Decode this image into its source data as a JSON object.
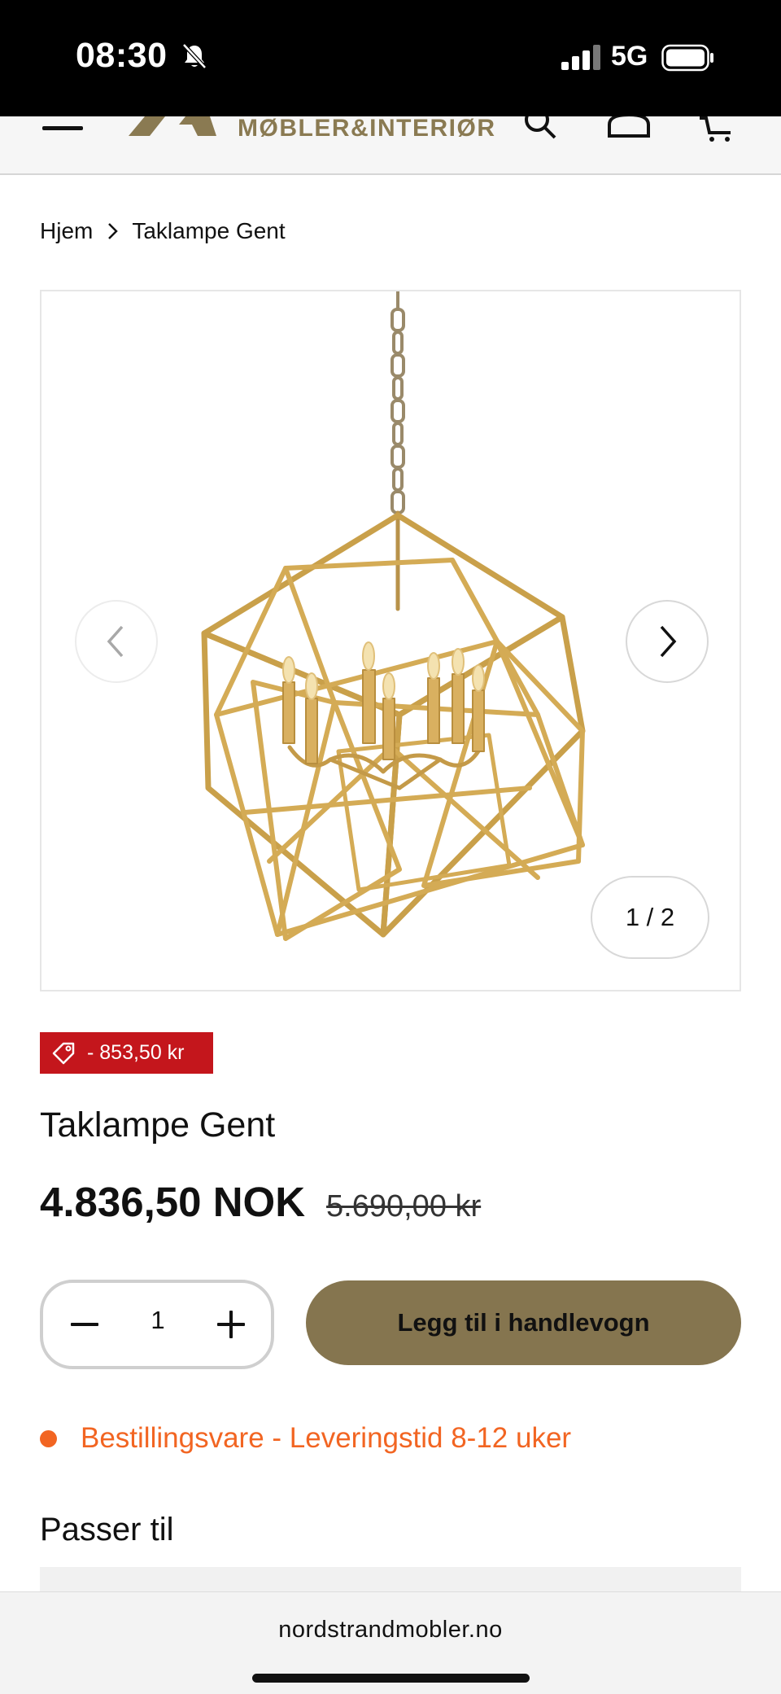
{
  "status_bar": {
    "time": "08:30",
    "network": "5G",
    "icons": [
      "bell-muted-icon",
      "signal-icon",
      "battery-icon"
    ]
  },
  "header": {
    "brand": "MØBLER&INTERIØR",
    "icons": [
      "menu-icon",
      "search-icon",
      "account-icon",
      "cart-icon"
    ]
  },
  "breadcrumb": {
    "home": "Hjem",
    "current": "Taklampe Gent"
  },
  "gallery": {
    "counter": "1 / 2",
    "current_index": 1,
    "total": 2
  },
  "product": {
    "discount_badge": "- 853,50 kr",
    "title": "Taklampe Gent",
    "price": "4.836,50 NOK",
    "compare_price": "5.690,00 kr",
    "quantity": "1",
    "add_to_cart": "Legg til i handlevogn",
    "stock_status": "Bestillingsvare - Leveringstid 8-12 uker"
  },
  "section": {
    "fits_with": "Passer til"
  },
  "browser": {
    "url": "nordstrandmobler.no"
  },
  "colors": {
    "accent": "#85754f",
    "badge": "#c4161c",
    "stock": "#f26522",
    "lamp_gold": "#c9a04a"
  }
}
